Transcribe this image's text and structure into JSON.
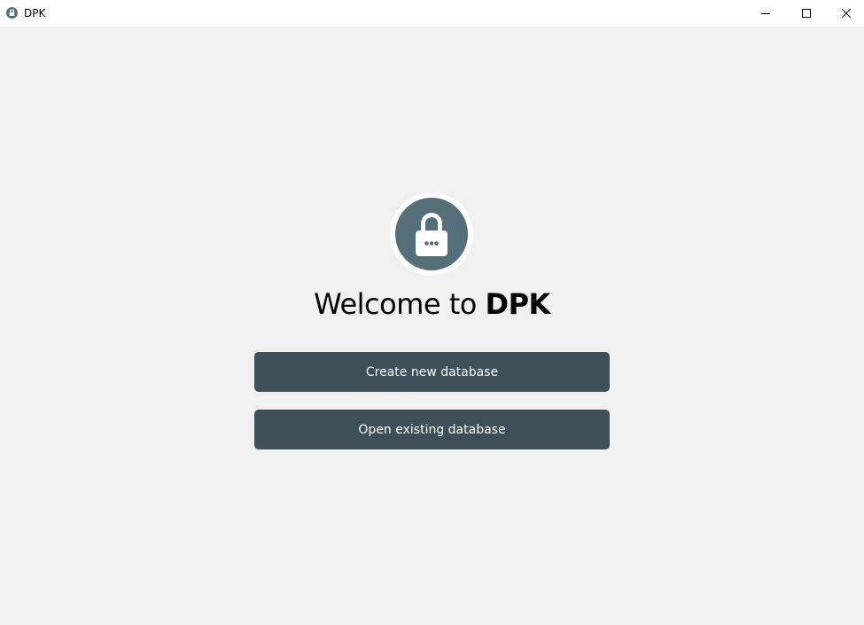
{
  "window": {
    "title": "DPK",
    "icons": {
      "app": "lock-icon",
      "minimize": "minimize-icon",
      "maximize": "maximize-icon",
      "close": "close-icon"
    }
  },
  "welcome": {
    "prefix": "Welcome to ",
    "brand": "DPK",
    "logo_icon": "padlock-icon"
  },
  "actions": {
    "create_label": "Create new database",
    "open_label": "Open existing database"
  },
  "colors": {
    "background": "#f0f0f0",
    "button": "#3d4f59",
    "logo_circle": "#546e7a",
    "button_text": "#ffffff"
  }
}
